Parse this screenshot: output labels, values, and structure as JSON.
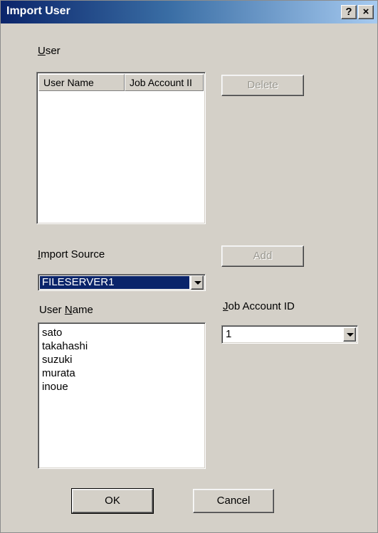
{
  "window": {
    "title": "Import User",
    "help_glyph": "?",
    "close_glyph": "×"
  },
  "user_group": {
    "label_hotkey": "U",
    "label_rest": "ser",
    "columns": [
      "User Name",
      "Job Account II"
    ],
    "rows": [],
    "delete_label": "Delete"
  },
  "import_source": {
    "label_hotkey": "I",
    "label_rest": "mport Source",
    "selected": "FILESERVER1",
    "add_label": "Add"
  },
  "user_name": {
    "label_pre": "User ",
    "label_hotkey": "N",
    "label_rest": "ame",
    "items": [
      "sato",
      "takahashi",
      "suzuki",
      "murata",
      "inoue"
    ]
  },
  "job_account": {
    "label_hotkey": "J",
    "label_rest": "ob Account ID",
    "selected": "1"
  },
  "footer": {
    "ok_label": "OK",
    "cancel_label": "Cancel"
  }
}
